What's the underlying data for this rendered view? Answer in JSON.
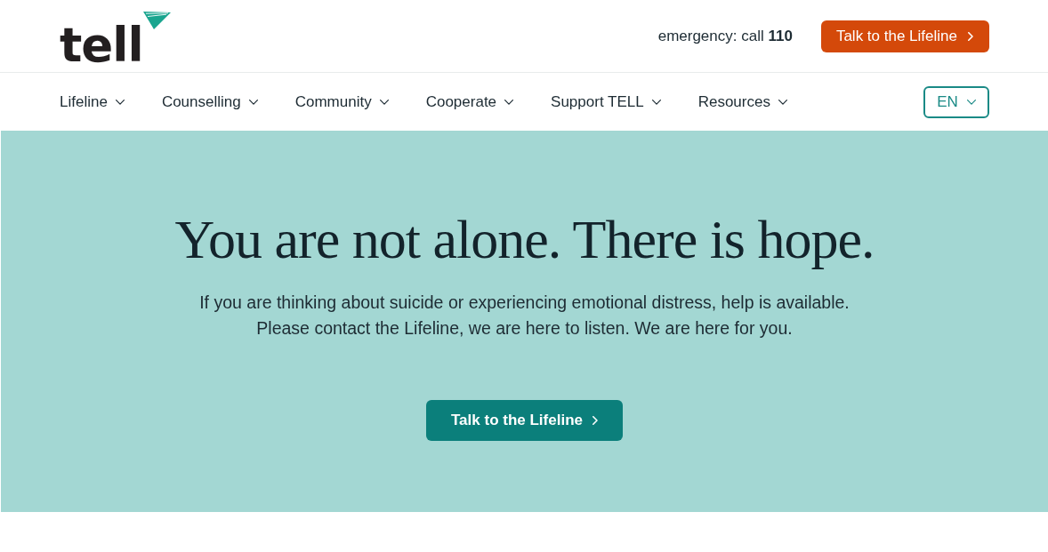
{
  "header": {
    "logo": {
      "text": "tell"
    },
    "emergency": "emergency: call **110**",
    "cta": {
      "label": "Talk to the Lifeline"
    }
  },
  "nav": {
    "items": [
      {
        "label": "Lifeline"
      },
      {
        "label": "Counselling"
      },
      {
        "label": "Community"
      },
      {
        "label": "Cooperate"
      },
      {
        "label": "Support TELL"
      },
      {
        "label": "Resources"
      }
    ],
    "language": {
      "label": "EN"
    }
  },
  "hero": {
    "heading": "You are not alone. There is hope.",
    "text": "If you are thinking about suicide or experiencing emotional distress, help is available.\nPlease contact the Lifeline, we are here to listen. We are here for you.",
    "button": {
      "label": "Talk to the Lifeline"
    }
  }
}
